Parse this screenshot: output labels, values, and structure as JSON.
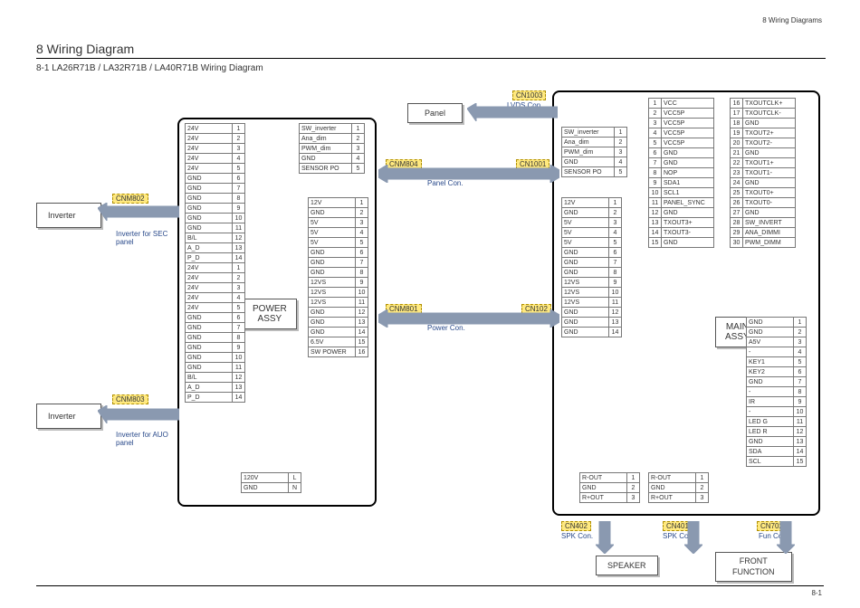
{
  "hdr_right": "8 Wiring Diagrams",
  "title": "8 Wiring Diagram",
  "subtitle": "8-1 LA26R71B / LA32R71B / LA40R71B Wiring Diagram",
  "footer": "8-1",
  "blocks": {
    "power": "POWER\nASSY",
    "main": "MAIN\nASSY",
    "panel": "Panel",
    "speaker": "SPEAKER",
    "front": "FRONT\nFUNCTION",
    "inverter1": "Inverter",
    "inverter2": "Inverter"
  },
  "notes": {
    "inv_sec": "Inverter for SEC panel",
    "inv_auo": "Inverter for AUO panel"
  },
  "connectors": {
    "cnm802": "CNM802",
    "cnm803": "CNM803",
    "cnm804": "CNM804",
    "cnm801": "CNM801",
    "cn1001": "CN1001",
    "cn102": "CN102",
    "cn1003": "CN1003",
    "cn402": "CN402",
    "cn401": "CN401",
    "cn702": "CN702"
  },
  "captions": {
    "lvds": "LVDS Con.",
    "panel": "Panel Con.",
    "power": "Power Con.",
    "spk1": "SPK Con.",
    "spk2": "SPK Con.",
    "fun": "Fun Con."
  },
  "pins": {
    "inv_main": [
      [
        "24V",
        1
      ],
      [
        "24V",
        2
      ],
      [
        "24V",
        3
      ],
      [
        "24V",
        4
      ],
      [
        "24V",
        5
      ],
      [
        "GND",
        6
      ],
      [
        "GND",
        7
      ],
      [
        "GND",
        8
      ],
      [
        "GND",
        9
      ],
      [
        "GND",
        10
      ],
      [
        "GND",
        11
      ],
      [
        "B/L",
        12
      ],
      [
        "A_D",
        13
      ],
      [
        "P_D",
        14
      ],
      [
        "24V",
        1
      ],
      [
        "24V",
        2
      ],
      [
        "24V",
        3
      ],
      [
        "24V",
        4
      ],
      [
        "24V",
        5
      ],
      [
        "GND",
        6
      ],
      [
        "GND",
        7
      ],
      [
        "GND",
        8
      ],
      [
        "GND",
        9
      ],
      [
        "GND",
        10
      ],
      [
        "GND",
        11
      ],
      [
        "B/L",
        12
      ],
      [
        "A_D",
        13
      ],
      [
        "P_D",
        14
      ]
    ],
    "sw1": [
      [
        "SW_inverter",
        1
      ],
      [
        "Ana_dim",
        2
      ],
      [
        "PWM_dim",
        3
      ],
      [
        "GND",
        4
      ],
      [
        "SENSOR PO",
        5
      ]
    ],
    "pwr": [
      [
        "12V",
        1
      ],
      [
        "GND",
        2
      ],
      [
        "5V",
        3
      ],
      [
        "5V",
        4
      ],
      [
        "5V",
        5
      ],
      [
        "GND",
        6
      ],
      [
        "GND",
        7
      ],
      [
        "GND",
        8
      ],
      [
        "12VS",
        9
      ],
      [
        "12VS",
        10
      ],
      [
        "12VS",
        11
      ],
      [
        "GND",
        12
      ],
      [
        "GND",
        13
      ],
      [
        "GND",
        14
      ],
      [
        "6.5V",
        15
      ],
      [
        "SW POWER",
        16
      ]
    ],
    "ac": [
      [
        "120V",
        "L"
      ],
      [
        "GND",
        "N"
      ]
    ],
    "sw2": [
      [
        "SW_inverter",
        1
      ],
      [
        "Ana_dim",
        2
      ],
      [
        "PWM_dim",
        3
      ],
      [
        "GND",
        4
      ],
      [
        "SENSOR PO",
        5
      ]
    ],
    "pwr2": [
      [
        "12V",
        1
      ],
      [
        "GND",
        2
      ],
      [
        "5V",
        3
      ],
      [
        "5V",
        4
      ],
      [
        "5V",
        5
      ],
      [
        "GND",
        6
      ],
      [
        "GND",
        7
      ],
      [
        "GND",
        8
      ],
      [
        "12VS",
        9
      ],
      [
        "12VS",
        10
      ],
      [
        "12VS",
        11
      ],
      [
        "GND",
        12
      ],
      [
        "GND",
        13
      ],
      [
        "GND",
        14
      ]
    ],
    "rout1": [
      [
        "R-OUT",
        1
      ],
      [
        "GND",
        2
      ],
      [
        "R+OUT",
        3
      ]
    ],
    "rout2": [
      [
        "R-OUT",
        1
      ],
      [
        "GND",
        2
      ],
      [
        "R+OUT",
        3
      ]
    ],
    "lvdsA": [
      [
        "VCC",
        1
      ],
      [
        "VCC5P",
        2
      ],
      [
        "VCC5P",
        3
      ],
      [
        "VCC5P",
        4
      ],
      [
        "VCC5P",
        5
      ],
      [
        "GND",
        6
      ],
      [
        "GND",
        7
      ],
      [
        "NOP",
        8
      ],
      [
        "SDA1",
        9
      ],
      [
        "SCL1",
        10
      ],
      [
        "PANEL_SYNC",
        11
      ],
      [
        "GND",
        12
      ],
      [
        "TXOUT3+",
        13
      ],
      [
        "TXOUT3-",
        14
      ],
      [
        "GND",
        15
      ]
    ],
    "lvdsB": [
      [
        "TXOUTCLK+",
        16
      ],
      [
        "TXOUTCLK-",
        17
      ],
      [
        "GND",
        18
      ],
      [
        "TXOUT2+",
        19
      ],
      [
        "TXOUT2-",
        20
      ],
      [
        "GND",
        21
      ],
      [
        "TXOUT1+",
        22
      ],
      [
        "TXOUT1-",
        23
      ],
      [
        "GND",
        24
      ],
      [
        "TXOUT0+",
        25
      ],
      [
        "TXOUT0-",
        26
      ],
      [
        "GND",
        27
      ],
      [
        "SW_INVERT",
        28
      ],
      [
        "ANA_DIMMI",
        29
      ],
      [
        "PWM_DIMM",
        30
      ]
    ],
    "fun": [
      [
        "GND",
        1
      ],
      [
        "GND",
        2
      ],
      [
        "A5V",
        3
      ],
      [
        "-",
        4
      ],
      [
        "KEY1",
        5
      ],
      [
        "KEY2",
        6
      ],
      [
        "GND",
        7
      ],
      [
        "-",
        8
      ],
      [
        "IR",
        9
      ],
      [
        "-",
        10
      ],
      [
        "LED G",
        11
      ],
      [
        "LED R",
        12
      ],
      [
        "GND",
        13
      ],
      [
        "SDA",
        14
      ],
      [
        "SCL",
        15
      ]
    ]
  }
}
